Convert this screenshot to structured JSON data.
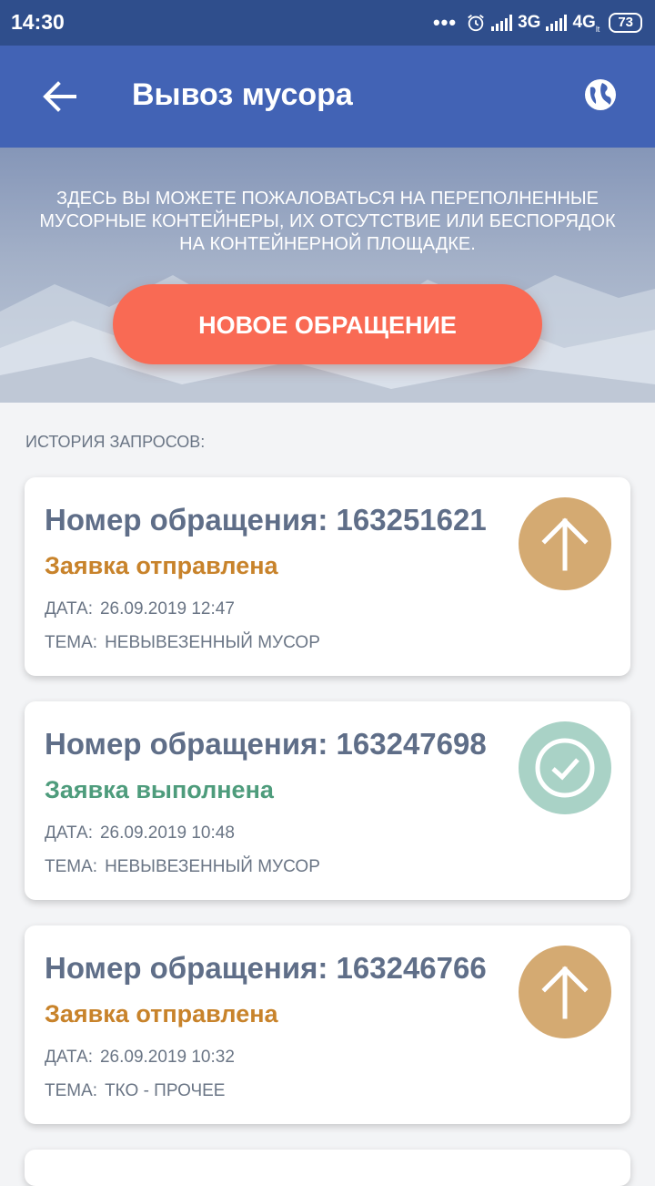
{
  "status_bar": {
    "time": "14:30",
    "dots": "•••",
    "net1": "3G",
    "net2": "4G",
    "net2_sub": "lt",
    "battery": "73"
  },
  "app_bar": {
    "title": "Вывоз мусора",
    "back_icon": "arrow-left-icon",
    "globe_icon": "globe-icon"
  },
  "hero": {
    "description": "Здесь вы можете пожаловаться на переполненные мусорные контейнеры, их отсутствие или беспорядок на контейнерной площадке.",
    "new_request_label": "НОВОЕ ОБРАЩЕНИЕ"
  },
  "history": {
    "title": "ИСТОРИЯ ЗАПРОСОВ:",
    "requests": [
      {
        "number_text": "Номер обращения: 163251621",
        "status": "Заявка отправлена",
        "status_type": "sent",
        "date_label": "ДАТА:",
        "date": "26.09.2019 12:47",
        "topic_label": "ТЕМА:",
        "topic": "НЕВЫВЕЗЕННЫЙ МУСОР",
        "icon": "arrow-up-icon",
        "status_color": "#c8832b",
        "icon_color": "#d4aa72"
      },
      {
        "number_text": "Номер обращения: 163247698",
        "status": "Заявка выполнена",
        "status_type": "done",
        "date_label": "ДАТА:",
        "date": "26.09.2019 10:48",
        "topic_label": "ТЕМА:",
        "topic": "НЕВЫВЕЗЕННЫЙ МУСОР",
        "icon": "check-circle-icon",
        "status_color": "#4e9c7c",
        "icon_color": "#a9d2c6"
      },
      {
        "number_text": "Номер обращения: 163246766",
        "status": "Заявка отправлена",
        "status_type": "sent",
        "date_label": "ДАТА:",
        "date": "26.09.2019 10:32",
        "topic_label": "ТЕМА:",
        "topic": "ТКО - ПРОЧЕЕ",
        "icon": "arrow-up-icon",
        "status_color": "#c8832b",
        "icon_color": "#d4aa72"
      }
    ]
  },
  "colors": {
    "status_bar": "#2f4e8c",
    "app_bar": "#4263b5",
    "button": "#f96a54"
  }
}
